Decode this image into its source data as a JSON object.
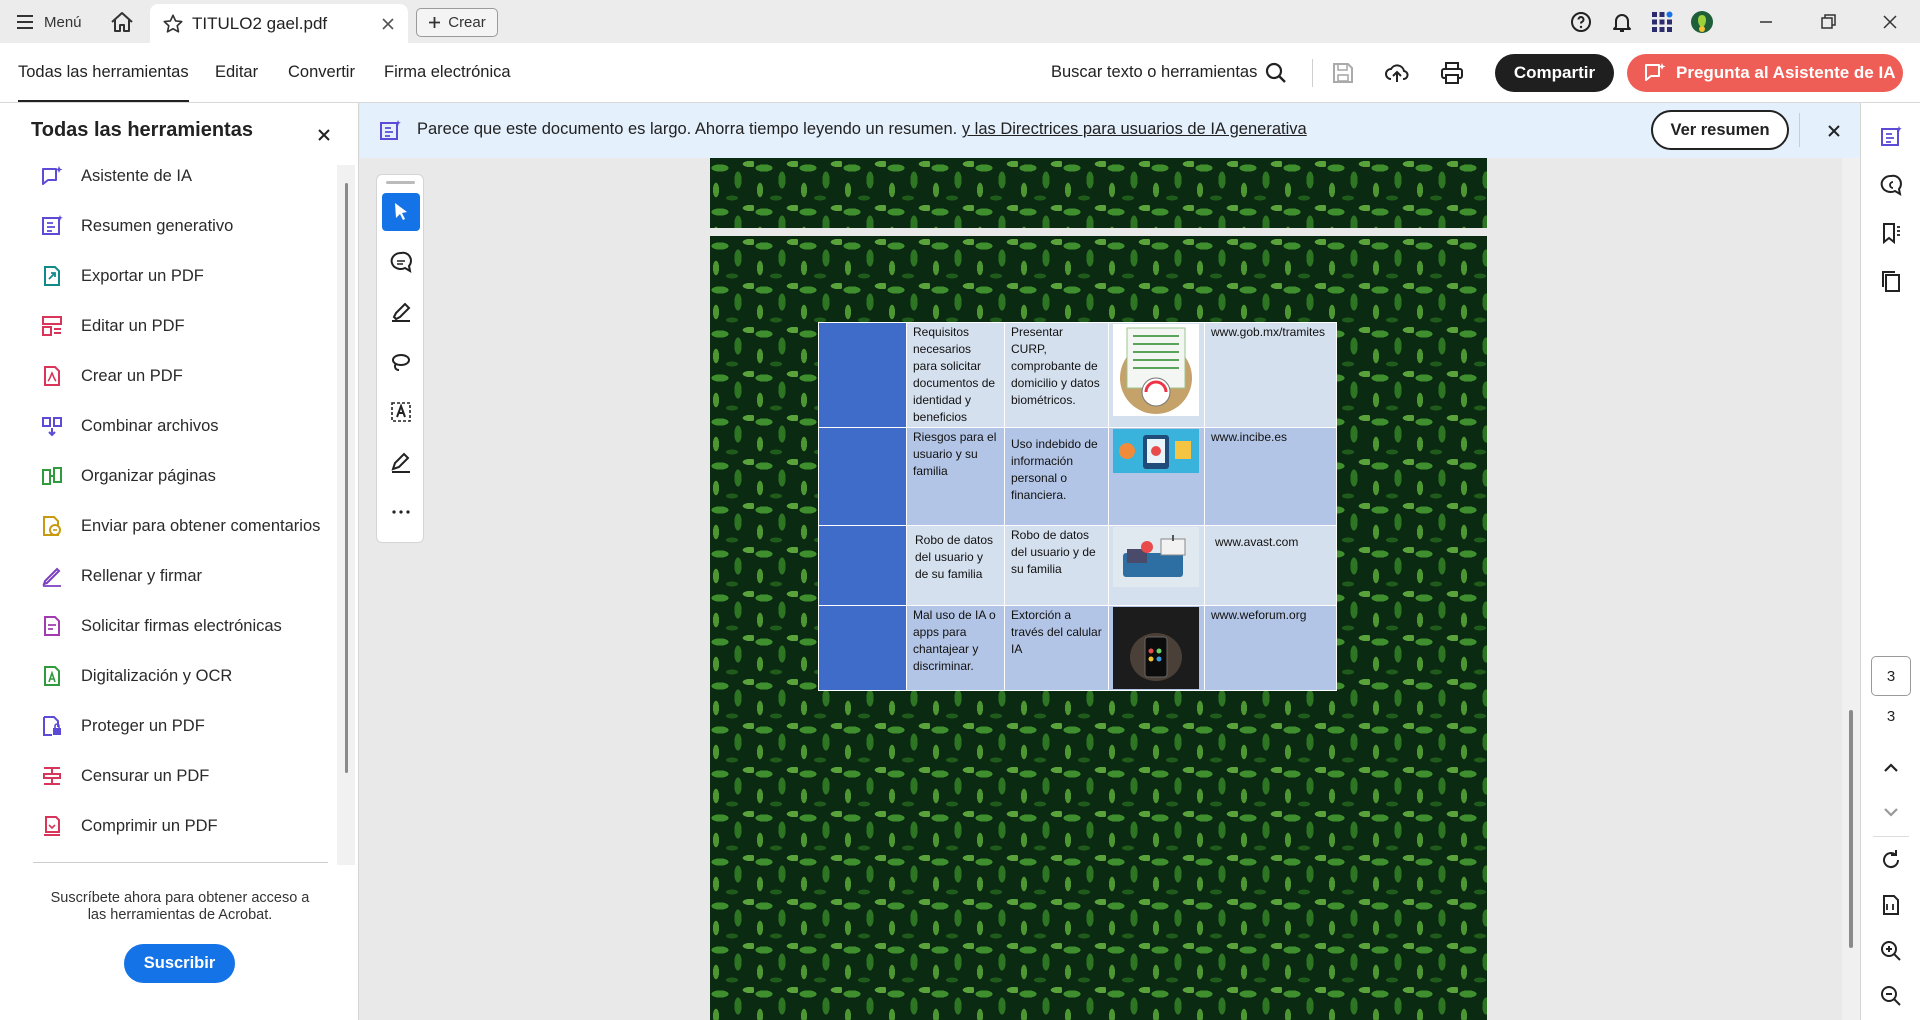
{
  "titlebar": {
    "menu_label": "Menú",
    "tab_title": "TITULO2 gael.pdf",
    "create_label": "Crear"
  },
  "toolbar": {
    "items": [
      "Todas las herramientas",
      "Editar",
      "Convertir",
      "Firma electrónica"
    ],
    "search_label": "Buscar texto o herramientas",
    "share_label": "Compartir",
    "ai_label": "Pregunta al Asistente de IA"
  },
  "sidebar": {
    "title": "Todas las herramientas",
    "items": [
      {
        "label": "Asistente de IA",
        "icon": "ai-assistant-icon"
      },
      {
        "label": "Resumen generativo",
        "icon": "generative-summary-icon"
      },
      {
        "label": "Exportar un PDF",
        "icon": "export-pdf-icon"
      },
      {
        "label": "Editar un PDF",
        "icon": "edit-pdf-icon"
      },
      {
        "label": "Crear un PDF",
        "icon": "create-pdf-icon"
      },
      {
        "label": "Combinar archivos",
        "icon": "combine-files-icon"
      },
      {
        "label": "Organizar páginas",
        "icon": "organize-pages-icon"
      },
      {
        "label": "Enviar para obtener comentarios",
        "icon": "send-for-comments-icon"
      },
      {
        "label": "Rellenar y firmar",
        "icon": "fill-sign-icon"
      },
      {
        "label": "Solicitar firmas electrónicas",
        "icon": "request-signatures-icon"
      },
      {
        "label": "Digitalización y OCR",
        "icon": "scan-ocr-icon"
      },
      {
        "label": "Proteger un PDF",
        "icon": "protect-pdf-icon"
      },
      {
        "label": "Censurar un PDF",
        "icon": "redact-pdf-icon"
      },
      {
        "label": "Comprimir un PDF",
        "icon": "compress-pdf-icon"
      }
    ],
    "subscribe_text": "Suscríbete ahora para obtener acceso a las herramientas de Acrobat.",
    "subscribe_button": "Suscribir"
  },
  "banner": {
    "text": "Parece que este documento es largo. Ahorra tiempo leyendo un resumen.",
    "link": "y las Directrices para usuarios de IA generativa",
    "button": "Ver resumen"
  },
  "document": {
    "rows": [
      {
        "col2": "Requisitos necesarios para solicitar documentos de identidad y beneficios",
        "col3": "Presentar CURP, comprobante de domicilio y datos biométricos.",
        "col5": "www.gob.mx/tramites"
      },
      {
        "col2": "Riesgos para el usuario y su familia",
        "col3": "Uso indebido de información personal o financiera.",
        "col5": "www.incibe.es"
      },
      {
        "col2": "Robo de datos del usuario y de su familia",
        "col3": "Robo de datos del usuario y de su familia",
        "col5": "www.avast.com"
      },
      {
        "col2": "Mal uso de IA o apps para chantajear y discriminar.",
        "col3": "Extorción a través del calular IA",
        "col5": "www.weforum.org"
      }
    ]
  },
  "pagenav": {
    "current": "3",
    "total": "3"
  },
  "colors": {
    "accent": "#1473e6",
    "ai_button": "#ee5e56",
    "banner_bg": "#e5f0fd",
    "table_blue": "#3f6cc9"
  }
}
